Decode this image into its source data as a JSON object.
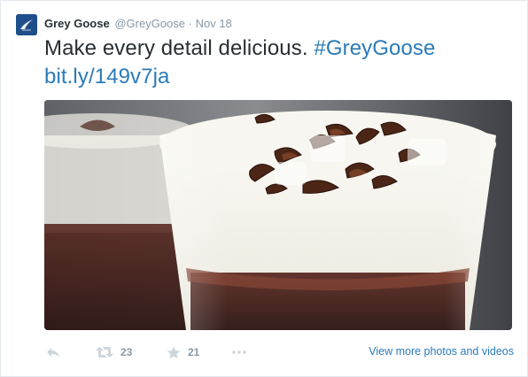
{
  "author": {
    "name": "Grey Goose",
    "handle": "@GreyGoose",
    "separator": "·",
    "time": "Nov 18",
    "avatar_icon": "grey-goose-logo-icon"
  },
  "tweet": {
    "text": "Make every detail delicious.",
    "hashtag": "#GreyGoose",
    "link": "bit.ly/149v7ja"
  },
  "media": {
    "description_icon": "dessert-photo"
  },
  "actions": {
    "reply_icon": "reply-icon",
    "retweet_icon": "retweet-icon",
    "retweet_count": "23",
    "favorite_icon": "star-icon",
    "favorite_count": "21",
    "more_icon": "more-dots-icon",
    "view_more_label": "View more photos and videos"
  },
  "colors": {
    "link": "#2b7bb9",
    "muted": "#8899a6",
    "text": "#292f33",
    "border": "#e1e8ed"
  }
}
